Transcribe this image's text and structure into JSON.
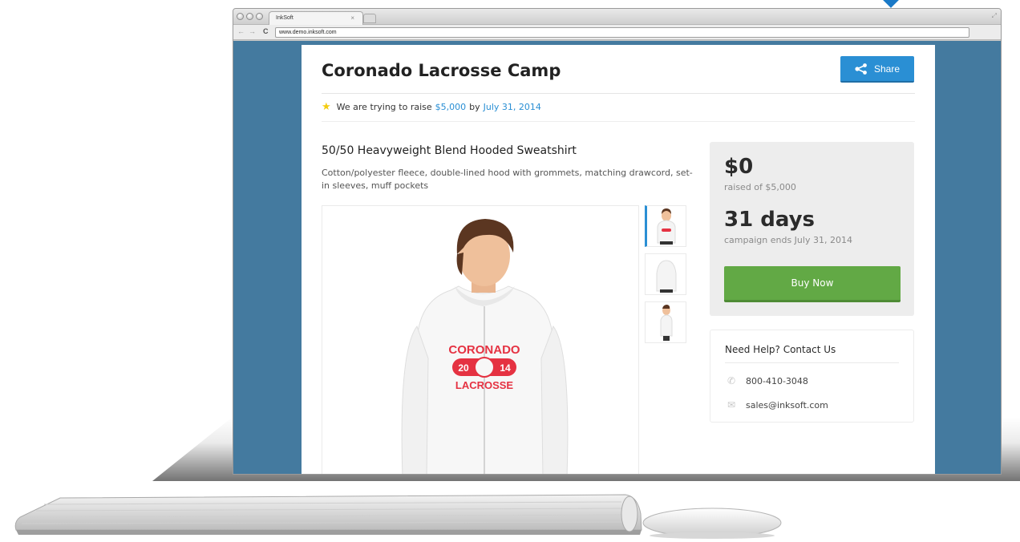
{
  "browser": {
    "tab_title": "InkSoft",
    "tab_close": "×",
    "url": "www.demo.inksoft.com",
    "nav_back": "←",
    "nav_forward": "→",
    "nav_reload": "C"
  },
  "campaign": {
    "title": "Coronado Lacrosse Camp",
    "share_label": "Share",
    "goal_prefix": "We are trying to raise",
    "goal_amount": "$5,000",
    "goal_by": "by",
    "goal_date": "July 31, 2014"
  },
  "product": {
    "title": "50/50 Heavyweight Blend Hooded Sweatshirt",
    "description": "Cotton/polyester fleece, double-lined hood with grommets, matching drawcord, set-in sleeves, muff pockets",
    "graphic_text_top": "CORONADO",
    "graphic_year_left": "20",
    "graphic_year_right": "14",
    "graphic_text_bottom": "LACROSSE"
  },
  "stats": {
    "raised_value": "$0",
    "raised_label": "raised of $5,000",
    "days_value": "31 days",
    "days_label": "campaign ends July 31, 2014",
    "buy_label": "Buy Now"
  },
  "help": {
    "title": "Need Help? Contact Us",
    "phone": "800-410-3048",
    "email": "sales@inksoft.com"
  },
  "colors": {
    "accent": "#2a8fd4",
    "buy": "#62a945",
    "backdrop": "#447a9f",
    "star": "#f4cc0f"
  },
  "icons": [
    "share-icon",
    "star-icon",
    "phone-icon",
    "envelope-icon"
  ]
}
